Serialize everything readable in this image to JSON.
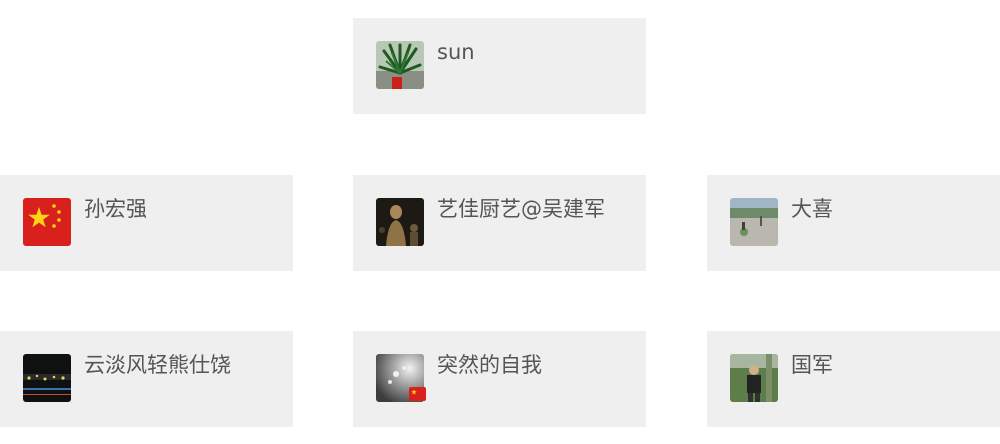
{
  "contacts": [
    {
      "name": "sun",
      "avatar_icon": "potted-plant-photo"
    },
    {
      "name": "孙宏强",
      "avatar_icon": "china-flag-photo"
    },
    {
      "name": "艺佳厨艺@吴建军",
      "avatar_icon": "buddha-statue-photo"
    },
    {
      "name": "大喜",
      "avatar_icon": "outdoor-park-photo"
    },
    {
      "name": "云淡风轻熊仕饶",
      "avatar_icon": "night-city-photo"
    },
    {
      "name": "突然的自我",
      "avatar_icon": "water-drops-photo",
      "badge_icon": "china-flag-badge"
    },
    {
      "name": "国军",
      "avatar_icon": "person-outdoor-photo"
    }
  ]
}
